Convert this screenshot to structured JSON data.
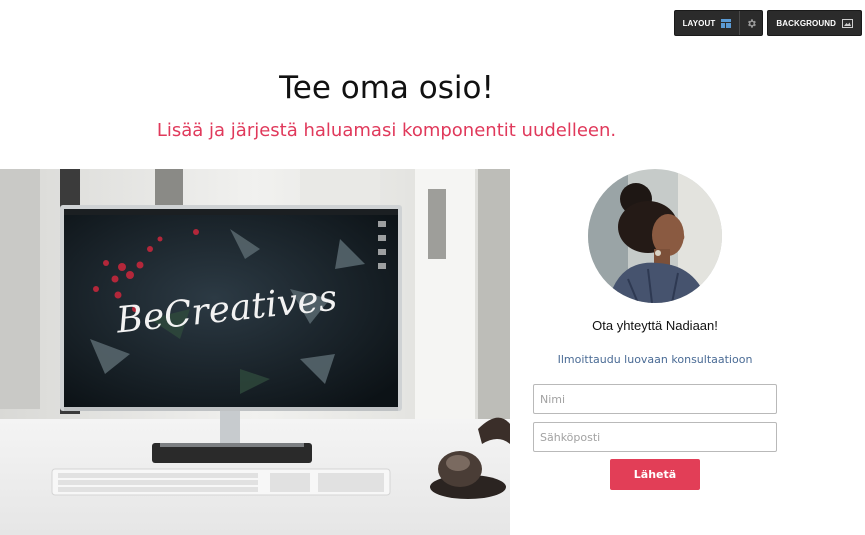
{
  "toolbar": {
    "layout_label": "LAYOUT",
    "layout_icon": "layout-grid-icon",
    "settings_icon": "gear-icon",
    "background_label": "BACKGROUND",
    "background_icon": "image-icon"
  },
  "section": {
    "title": "Tee oma osio!",
    "subtitle": "Lisää ja järjestä haluamasi komponentit uudelleen."
  },
  "hero": {
    "screen_text": "BeCreatives"
  },
  "contact": {
    "text": "Ota yhteyttä Nadiaan!",
    "link": "Ilmoittaudu luovaan konsultaatioon",
    "name_placeholder": "Nimi",
    "email_placeholder": "Sähköposti",
    "submit_label": "Lähetä"
  },
  "colors": {
    "accent": "#e0395b",
    "button": "#e23e57",
    "link": "#4a6b95",
    "toolbar": "#2b2b2b"
  }
}
